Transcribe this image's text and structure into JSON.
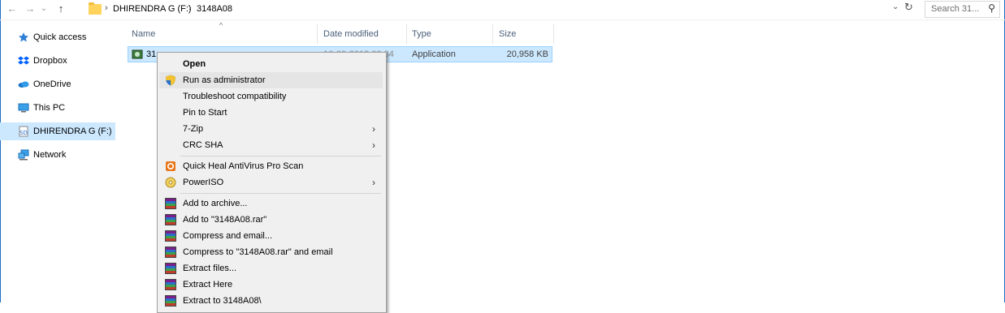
{
  "address": {
    "crumbs": [
      "DHIRENDRA G (F:)",
      "3148A08"
    ],
    "separator": "›",
    "search_placeholder": "Search 31...",
    "back": "←",
    "forward": "→",
    "recent": "⌄",
    "up": "↑",
    "dropdown": "⌄",
    "refresh": "↻",
    "search_icon": "⚲"
  },
  "nav": {
    "items": [
      {
        "label": "Quick access",
        "icon": "star-pin-icon"
      },
      {
        "label": "Dropbox",
        "icon": "dropbox-icon"
      },
      {
        "label": "OneDrive",
        "icon": "onedrive-icon"
      },
      {
        "label": "This PC",
        "icon": "monitor-icon"
      },
      {
        "label": "DHIRENDRA G (F:)",
        "icon": "sd-card-icon"
      },
      {
        "label": "Network",
        "icon": "network-icon"
      }
    ],
    "selected_index": 4
  },
  "columns": {
    "name": "Name",
    "date": "Date modified",
    "type": "Type",
    "size": "Size",
    "sort_indicator": "^"
  },
  "file": {
    "name": "31",
    "date": "10-09-2018 09:34",
    "type": "Application",
    "size": "20,958 KB"
  },
  "menu": {
    "items": [
      {
        "label": "Open",
        "bold": true
      },
      {
        "label": "Run as administrator",
        "icon": "uac-shield-icon"
      },
      {
        "label": "Troubleshoot compatibility"
      },
      {
        "label": "Pin to Start"
      },
      {
        "label": "7-Zip",
        "submenu": true
      },
      {
        "label": "CRC SHA",
        "submenu": true
      },
      {
        "label": "Quick Heal AntiVirus Pro Scan",
        "icon": "quickheal-icon"
      },
      {
        "label": "PowerISO",
        "icon": "poweriso-icon",
        "submenu": true
      },
      {
        "label": "Add to archive...",
        "icon": "winrar-icon"
      },
      {
        "label": "Add to \"3148A08.rar\"",
        "icon": "winrar-icon"
      },
      {
        "label": "Compress and email...",
        "icon": "winrar-icon"
      },
      {
        "label": "Compress to \"3148A08.rar\" and email",
        "icon": "winrar-icon"
      },
      {
        "label": "Extract files...",
        "icon": "winrar-icon"
      },
      {
        "label": "Extract Here",
        "icon": "winrar-icon"
      },
      {
        "label": "Extract to 3148A08\\",
        "icon": "winrar-icon"
      }
    ],
    "submenu_arrow": "›"
  },
  "colors": {
    "selection": "#cce8ff",
    "selection_border": "#99d1ff",
    "menu_bg": "#f0f0f0",
    "hover": "#e5e5e5",
    "header_text": "#4c607a"
  }
}
